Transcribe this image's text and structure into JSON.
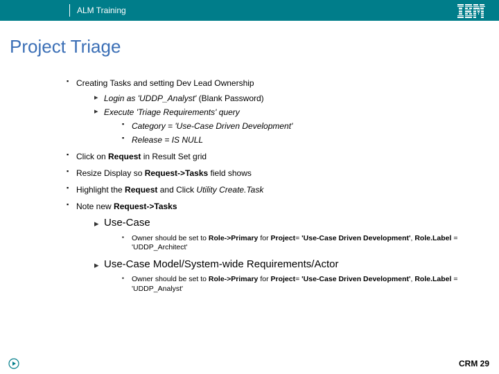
{
  "header": {
    "title": "ALM Training",
    "logo_name": "ibm-logo"
  },
  "page": {
    "title": "Project Triage"
  },
  "content": {
    "b1": {
      "text": "Creating Tasks and setting Dev Lead Ownership",
      "sub": {
        "a1_pre": "Login as ",
        "a1_em": "'UDDP_Analyst'",
        "a1_post": " (Blank Password)",
        "a2": "Execute 'Triage Requirements' query",
        "a2_sub": {
          "c1_pre": "Category = ",
          "c1_em": "'Use-Case Driven Development'",
          "c2": "Release = IS NULL"
        }
      }
    },
    "b2_pre": "Click on ",
    "b2_strong": "Request",
    "b2_post": " in Result Set grid",
    "b3_pre": "Resize Display so ",
    "b3_strong": "Request->Tasks",
    "b3_post": " field shows",
    "b4_pre": "Highlight the ",
    "b4_strong": "Request",
    "b4_mid": " and Click ",
    "b4_em": "Utility Create.Task",
    "b5_pre": "Note new ",
    "b5_strong": "Request->Tasks",
    "b5_sub": {
      "d1": "Use-Case",
      "d1_owner_pre": "Owner should be set to ",
      "d1_owner_s1": "Role->Primary",
      "d1_owner_mid1": " for ",
      "d1_owner_s2": "Project",
      "d1_owner_mid2": "= ",
      "d1_owner_s3": "'Use-Case Driven Development'",
      "d1_owner_mid3": ", ",
      "d1_owner_s4": "Role.Label",
      "d1_owner_post": " = 'UDDP_Architect'",
      "d2": "Use-Case Model/System-wide Requirements/Actor",
      "d2_owner_pre": "Owner should be set to ",
      "d2_owner_s1": "Role->Primary",
      "d2_owner_mid1": " for ",
      "d2_owner_s2": "Project",
      "d2_owner_mid2": "= ",
      "d2_owner_s3": "'Use-Case Driven Development'",
      "d2_owner_mid3": ", ",
      "d2_owner_s4": "Role.Label",
      "d2_owner_post": " = 'UDDP_Analyst'"
    }
  },
  "footer": {
    "right": "CRM 29"
  }
}
